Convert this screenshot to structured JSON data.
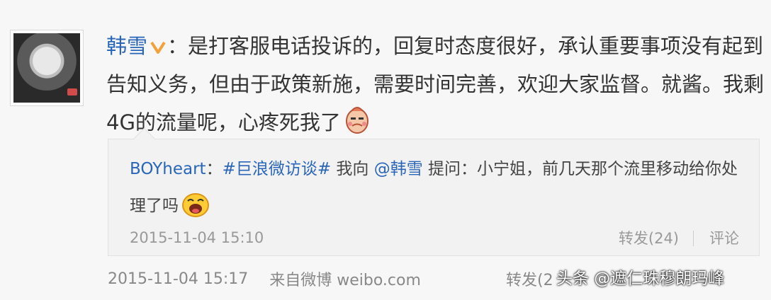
{
  "post": {
    "author": "韩雪",
    "separator": "：",
    "text": "是打客服电话投诉的，回复时态度很好，承认重要事项没有起到告知义务，但由于政策新施，需要时间完善，欢迎大家监督。就酱。我剩4G的流量呢，心疼死我了",
    "emoji": "heart-broken-face-emoji"
  },
  "quote": {
    "user": "BOYheart",
    "colon": "：",
    "topic": "#巨浪微访谈#",
    "text1": " 我向 ",
    "mention": "@韩雪",
    "text2": " 提问：小宁姐，前几天那个流里移动给你处理了吗",
    "emoji": "laughing-face-emoji",
    "time": "2015-11-04 15:10",
    "repost_label": "转发(24)",
    "comment_label": "评论"
  },
  "footer": {
    "time": "2015-11-04 15:17",
    "source": "来自微博 weibo.com",
    "repost_label": "转发(2"
  },
  "watermark": "头条 @遮仁珠穆朗玛峰",
  "colors": {
    "link": "#2a66b8",
    "text": "#333333",
    "muted": "#999999",
    "background": "#f7f7f7"
  }
}
